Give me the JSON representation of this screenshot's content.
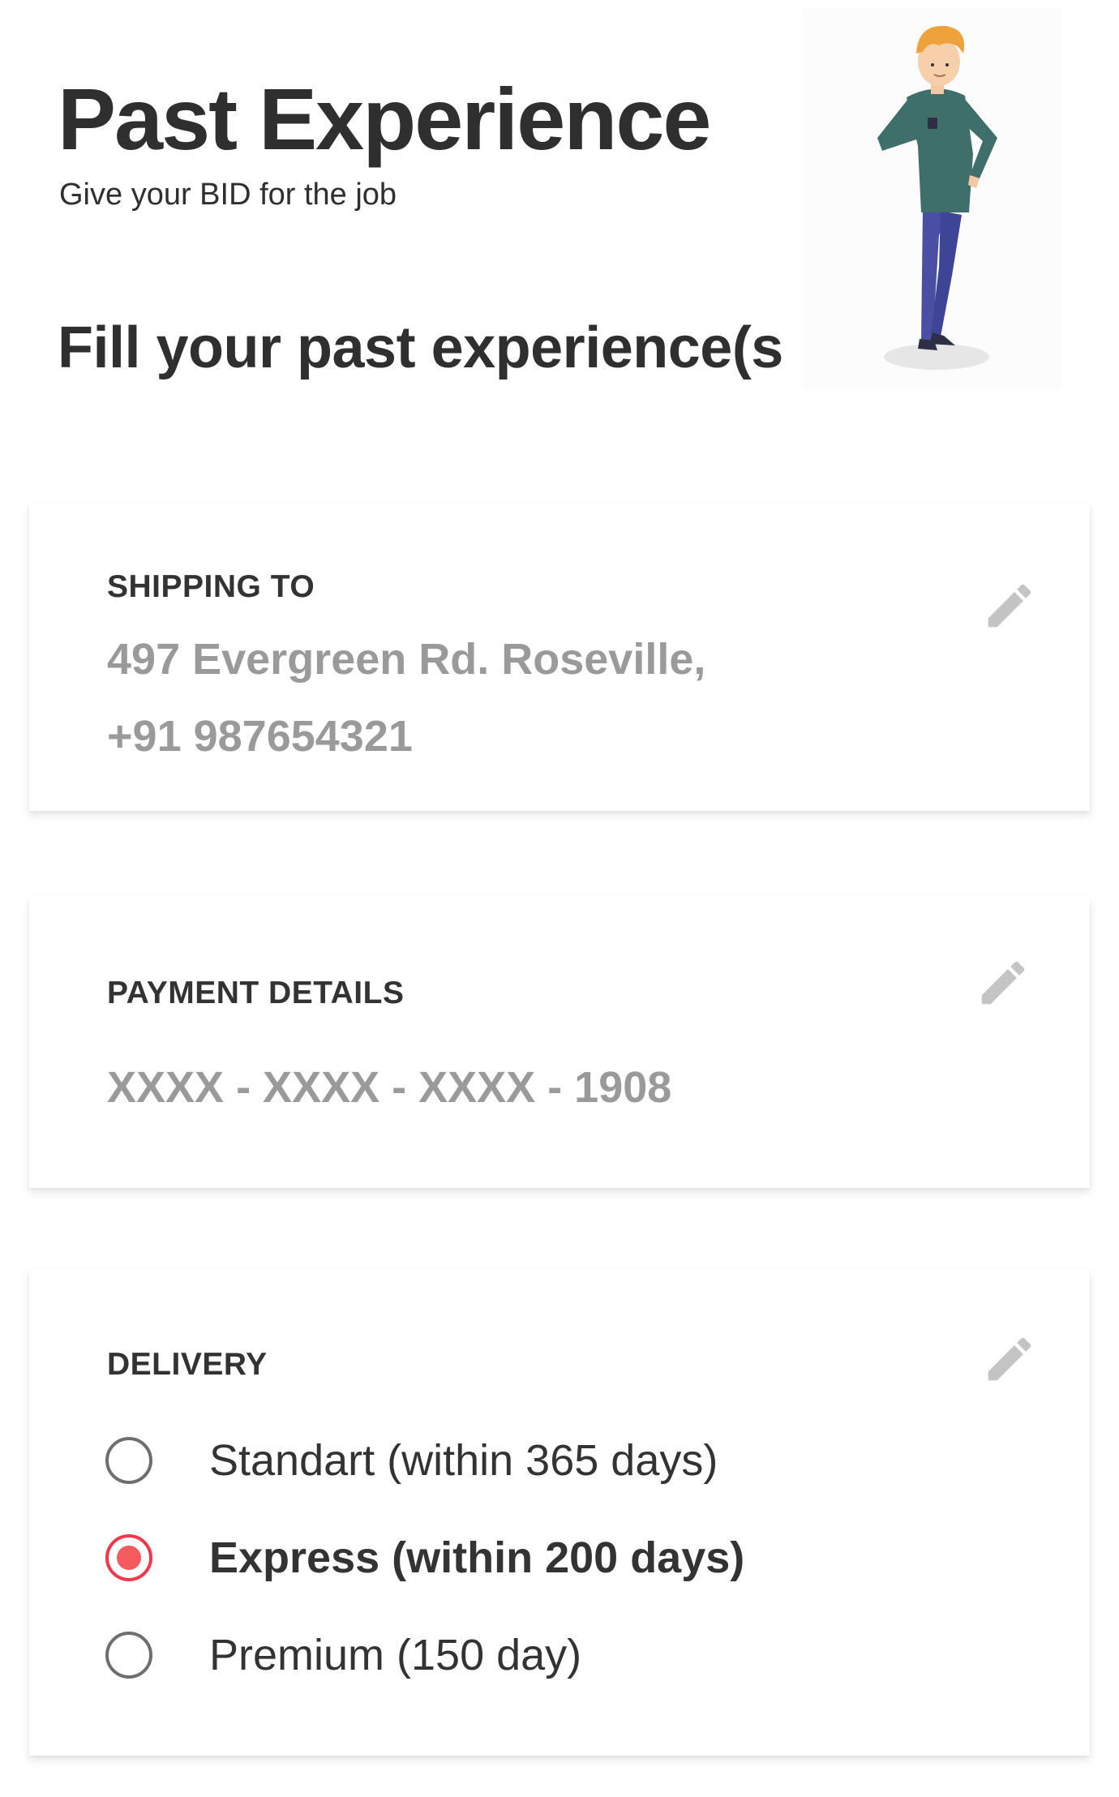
{
  "header": {
    "title": "Past Experience",
    "subtitle": "Give your BID for the job",
    "section_heading": "Fill your past experience(s"
  },
  "illustration": {
    "icon": "person-checking-watch-illustration"
  },
  "shipping": {
    "label": "SHIPPING TO",
    "address": "497 Evergreen Rd. Roseville,",
    "phone": "+91 987654321",
    "edit_icon": "pencil-icon"
  },
  "payment": {
    "label": "PAYMENT DETAILS",
    "card_number": "XXXX - XXXX - XXXX - 1908",
    "edit_icon": "pencil-icon"
  },
  "delivery": {
    "label": "DELIVERY",
    "edit_icon": "pencil-icon",
    "options": [
      {
        "label": "Standart (within 365 days)",
        "selected": false
      },
      {
        "label": "Express (within 200 days)",
        "selected": true
      },
      {
        "label": "Premium (150 day)",
        "selected": false
      }
    ]
  },
  "colors": {
    "accent": "#f0384a",
    "muted_text": "#9a9a9a",
    "primary_text": "#333333",
    "edit_icon": "#c4c4c4"
  }
}
